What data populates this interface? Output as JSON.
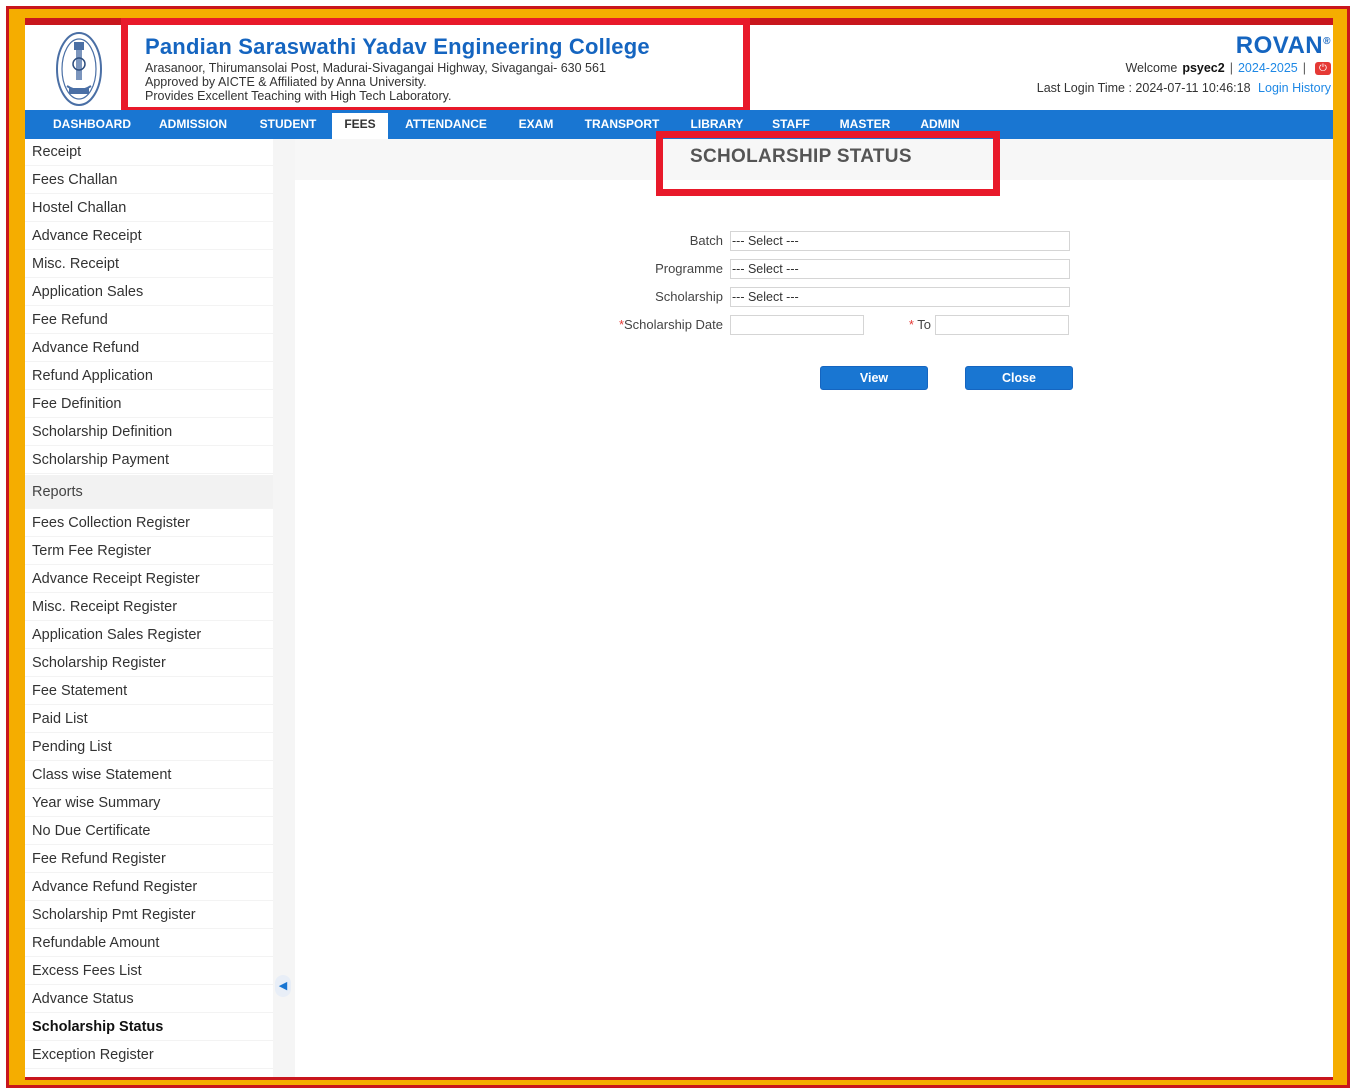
{
  "header": {
    "college_name": "Pandian Saraswathi Yadav Engineering College",
    "address": "Arasanoor, Thirumansolai Post, Madurai-Sivagangai Highway, Sivagangai- 630 561",
    "approval": "Approved by AICTE & Affiliated by Anna University.",
    "tagline": "Provides Excellent Teaching with High Tech Laboratory.",
    "brand": "ROVAN",
    "brand_mark": "®",
    "welcome_label": "Welcome",
    "username": "psyec2",
    "separator": "|",
    "academic_year": "2024-2025",
    "last_login_label": "Last Login Time : 2024-07-11 10:46:18",
    "login_history": "Login History"
  },
  "nav": [
    {
      "label": "DASHBOARD",
      "active": false
    },
    {
      "label": "ADMISSION",
      "active": false
    },
    {
      "label": "STUDENT",
      "active": false
    },
    {
      "label": "FEES",
      "active": true
    },
    {
      "label": "ATTENDANCE",
      "active": false
    },
    {
      "label": "EXAM",
      "active": false
    },
    {
      "label": "TRANSPORT",
      "active": false
    },
    {
      "label": "LIBRARY",
      "active": false
    },
    {
      "label": "STAFF",
      "active": false
    },
    {
      "label": "MASTER",
      "active": false
    },
    {
      "label": "ADMIN",
      "active": false
    }
  ],
  "sidebar": {
    "items": [
      "Receipt",
      "Fees Challan",
      "Hostel Challan",
      "Advance Receipt",
      "Misc. Receipt",
      "Application Sales",
      "Fee Refund",
      "Advance Refund",
      "Refund Application",
      "Fee Definition",
      "Scholarship Definition",
      "Scholarship Payment"
    ],
    "reports_header": "Reports",
    "reports": [
      "Fees Collection Register",
      "Term Fee Register",
      "Advance Receipt Register",
      "Misc. Receipt Register",
      "Application Sales Register",
      "Scholarship Register",
      "Fee Statement",
      "Paid List",
      "Pending List",
      "Class wise Statement",
      "Year wise Summary",
      "No Due Certificate",
      "Fee Refund Register",
      "Advance Refund Register",
      "Scholarship Pmt Register",
      "Refundable Amount",
      "Excess Fees List",
      "Advance Status",
      "Scholarship Status",
      "Exception Register"
    ],
    "active": "Scholarship Status"
  },
  "main": {
    "title": "SCHOLARSHIP STATUS",
    "form": {
      "batch_label": "Batch",
      "batch_value": "--- Select ---",
      "programme_label": "Programme",
      "programme_value": "--- Select ---",
      "scholarship_label": "Scholarship",
      "scholarship_value": "--- Select ---",
      "required_mark": "*",
      "date_label": "Scholarship Date",
      "date_from_value": "",
      "to_label": "To",
      "date_to_value": ""
    },
    "view_button": "View",
    "close_button": "Close"
  },
  "colors": {
    "accent": "#1976d2",
    "highlight": "#e8192a",
    "frame": "#f5ad00"
  }
}
